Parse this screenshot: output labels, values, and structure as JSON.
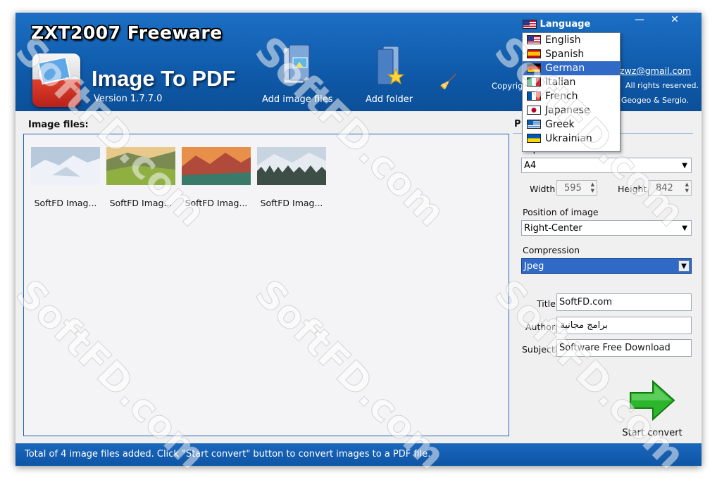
{
  "header": {
    "brand": "ZXT2007 Freeware",
    "app_title": "Image To PDF",
    "version": "Version 1.7.7.0",
    "add_image_files": "Add image files",
    "add_folder": "Add folder",
    "copyright": "Copyright",
    "email": "zwz@gmail.com",
    "rights": "All rights reserved.",
    "thanks": "k Geogeo & Sergio."
  },
  "language_menu": {
    "button_label": "Language",
    "items": [
      {
        "label": "English",
        "flag": "flag-us"
      },
      {
        "label": "Spanish",
        "flag": "flag-es"
      },
      {
        "label": "German",
        "flag": "flag-de"
      },
      {
        "label": "Italian",
        "flag": "flag-it"
      },
      {
        "label": "French",
        "flag": "flag-fr"
      },
      {
        "label": "Japanese",
        "flag": "flag-jp"
      },
      {
        "label": "Greek",
        "flag": "flag-gr"
      },
      {
        "label": "Ukrainian",
        "flag": "flag-ua"
      }
    ],
    "selected": "German"
  },
  "images_panel": {
    "label": "Image files:",
    "items": [
      {
        "caption": "SoftFD Imag...",
        "icon": "photo-snow-icon"
      },
      {
        "caption": "SoftFD Imag...",
        "icon": "photo-valley-icon"
      },
      {
        "caption": "SoftFD Imag...",
        "icon": "photo-mountain-icon"
      },
      {
        "caption": "SoftFD Imag...",
        "icon": "photo-forest-icon"
      }
    ]
  },
  "pdf_settings": {
    "title_partial": "P",
    "paper_size_label": "Paper size",
    "paper_size_value": "A4",
    "width_label": "Width",
    "width_value": "595",
    "height_label": "Height",
    "height_value": "842",
    "position_label": "Position of image",
    "position_value": "Right-Center",
    "compression_label": "Compression",
    "compression_value": "Jpeg",
    "title_label": "Title",
    "title_value": "SoftFD.com",
    "author_label": "Author",
    "author_value": "برامج مجانية",
    "subject_label": "Subject",
    "subject_value": "Software Free Download",
    "start_label": "Start convert"
  },
  "status": "Total of 4 image files added. Click \"Start convert\" button to convert images to a PDF file.",
  "watermark": "SoftFD.com",
  "window_controls": {
    "minimize": "—",
    "close": "✕"
  },
  "colors": {
    "header": "#0f5aaa",
    "selection": "#3169c6",
    "panel_border": "#1f65b8"
  }
}
